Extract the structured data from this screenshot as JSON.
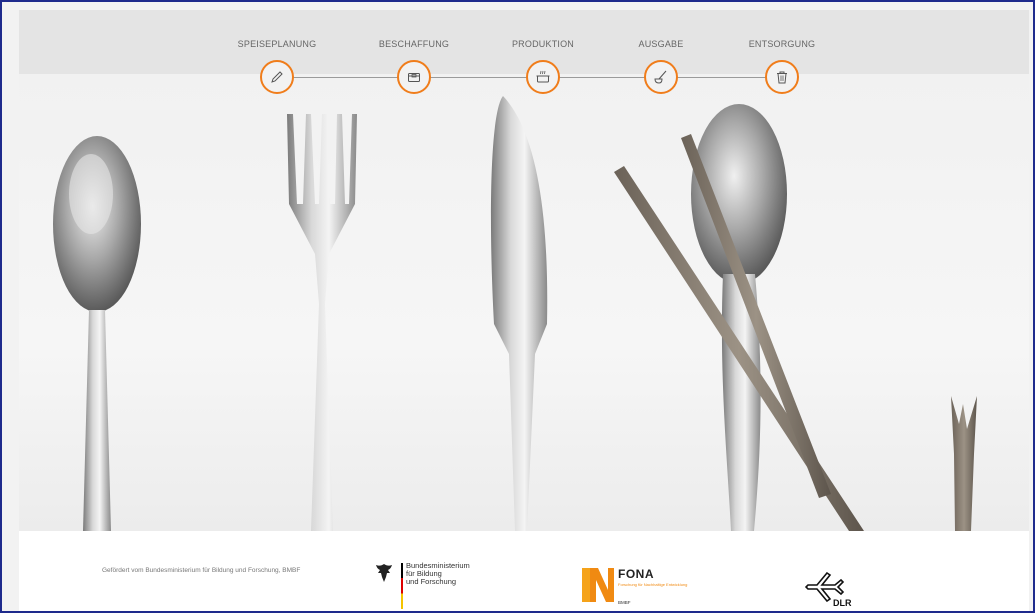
{
  "process_steps": [
    {
      "label": "SPEISEPLANUNG",
      "icon": "pencil-icon"
    },
    {
      "label": "BESCHAFFUNG",
      "icon": "box-icon"
    },
    {
      "label": "PRODUKTION",
      "icon": "cooking-pot-icon"
    },
    {
      "label": "AUSGABE",
      "icon": "ladle-icon"
    },
    {
      "label": "ENTSORGUNG",
      "icon": "trash-icon"
    }
  ],
  "footer": {
    "funding_text": "Gefördert vom Bundesministerium für Bildung und Forschung, BMBF",
    "bmbf_line1": "Bundesministerium",
    "bmbf_line2": "für Bildung",
    "bmbf_line3": "und Forschung",
    "fona_name": "FONA",
    "fona_sub": "Forschung für Nachhaltige Entwicklung",
    "fona_bmbf": "BMBF",
    "dlr_name": "DLR"
  },
  "colors": {
    "accent": "#f07d1b",
    "frame": "#1e2a8c"
  }
}
